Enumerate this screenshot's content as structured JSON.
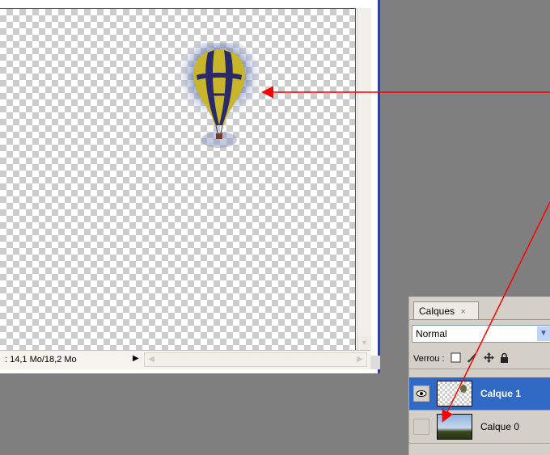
{
  "document": {
    "status_text": ": 14,1 Mo/18,2 Mo"
  },
  "layers_panel": {
    "tab_label": "Calques",
    "tab_close": "×",
    "blend_mode": "Normal",
    "lock_label": "Verrou :",
    "layers": [
      {
        "name": "Calque 1",
        "selected": true,
        "visible": true
      },
      {
        "name": "Calque 0",
        "selected": false,
        "visible": false
      }
    ]
  },
  "colors": {
    "selection_blue": "#3169c6",
    "window_border": "#1f3fd1",
    "annotation_red": "#ff0000",
    "workspace_gray": "#7f7f7f"
  },
  "icons": [
    "eye-icon",
    "lock-transparency-icon",
    "lock-paint-icon",
    "lock-move-icon",
    "lock-all-icon",
    "chevron-down-icon",
    "close-icon"
  ]
}
